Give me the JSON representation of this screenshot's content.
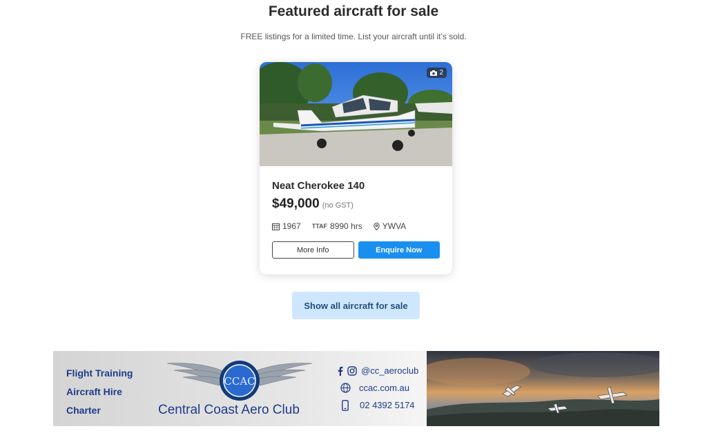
{
  "header": {
    "title": "Featured aircraft for sale",
    "subtitle": "FREE listings for a limited time. List your aircraft until it’s sold."
  },
  "listing": {
    "photo_count": "2",
    "title": "Neat Cherokee 140",
    "price": "$49,000",
    "price_note": "(no GST)",
    "year": "1967",
    "ttaf_label": "TTAF",
    "ttaf_value": "8990 hrs",
    "location": "YWVA",
    "more_info_label": "More Info",
    "enquire_label": "Enquire Now"
  },
  "show_all_label": "Show all aircraft for sale",
  "banner": {
    "services": [
      "Flight Training",
      "Aircraft Hire",
      "Charter"
    ],
    "logo_text": "CCAC",
    "club_name": "Central Coast Aero Club",
    "social_handle": "@cc_aeroclub",
    "website": "ccac.com.au",
    "phone": "02 4392 5174"
  },
  "colors": {
    "primary_button": "#1a8ff0",
    "show_all_bg": "#cfe7fc",
    "banner_text": "#1e3a8a"
  }
}
